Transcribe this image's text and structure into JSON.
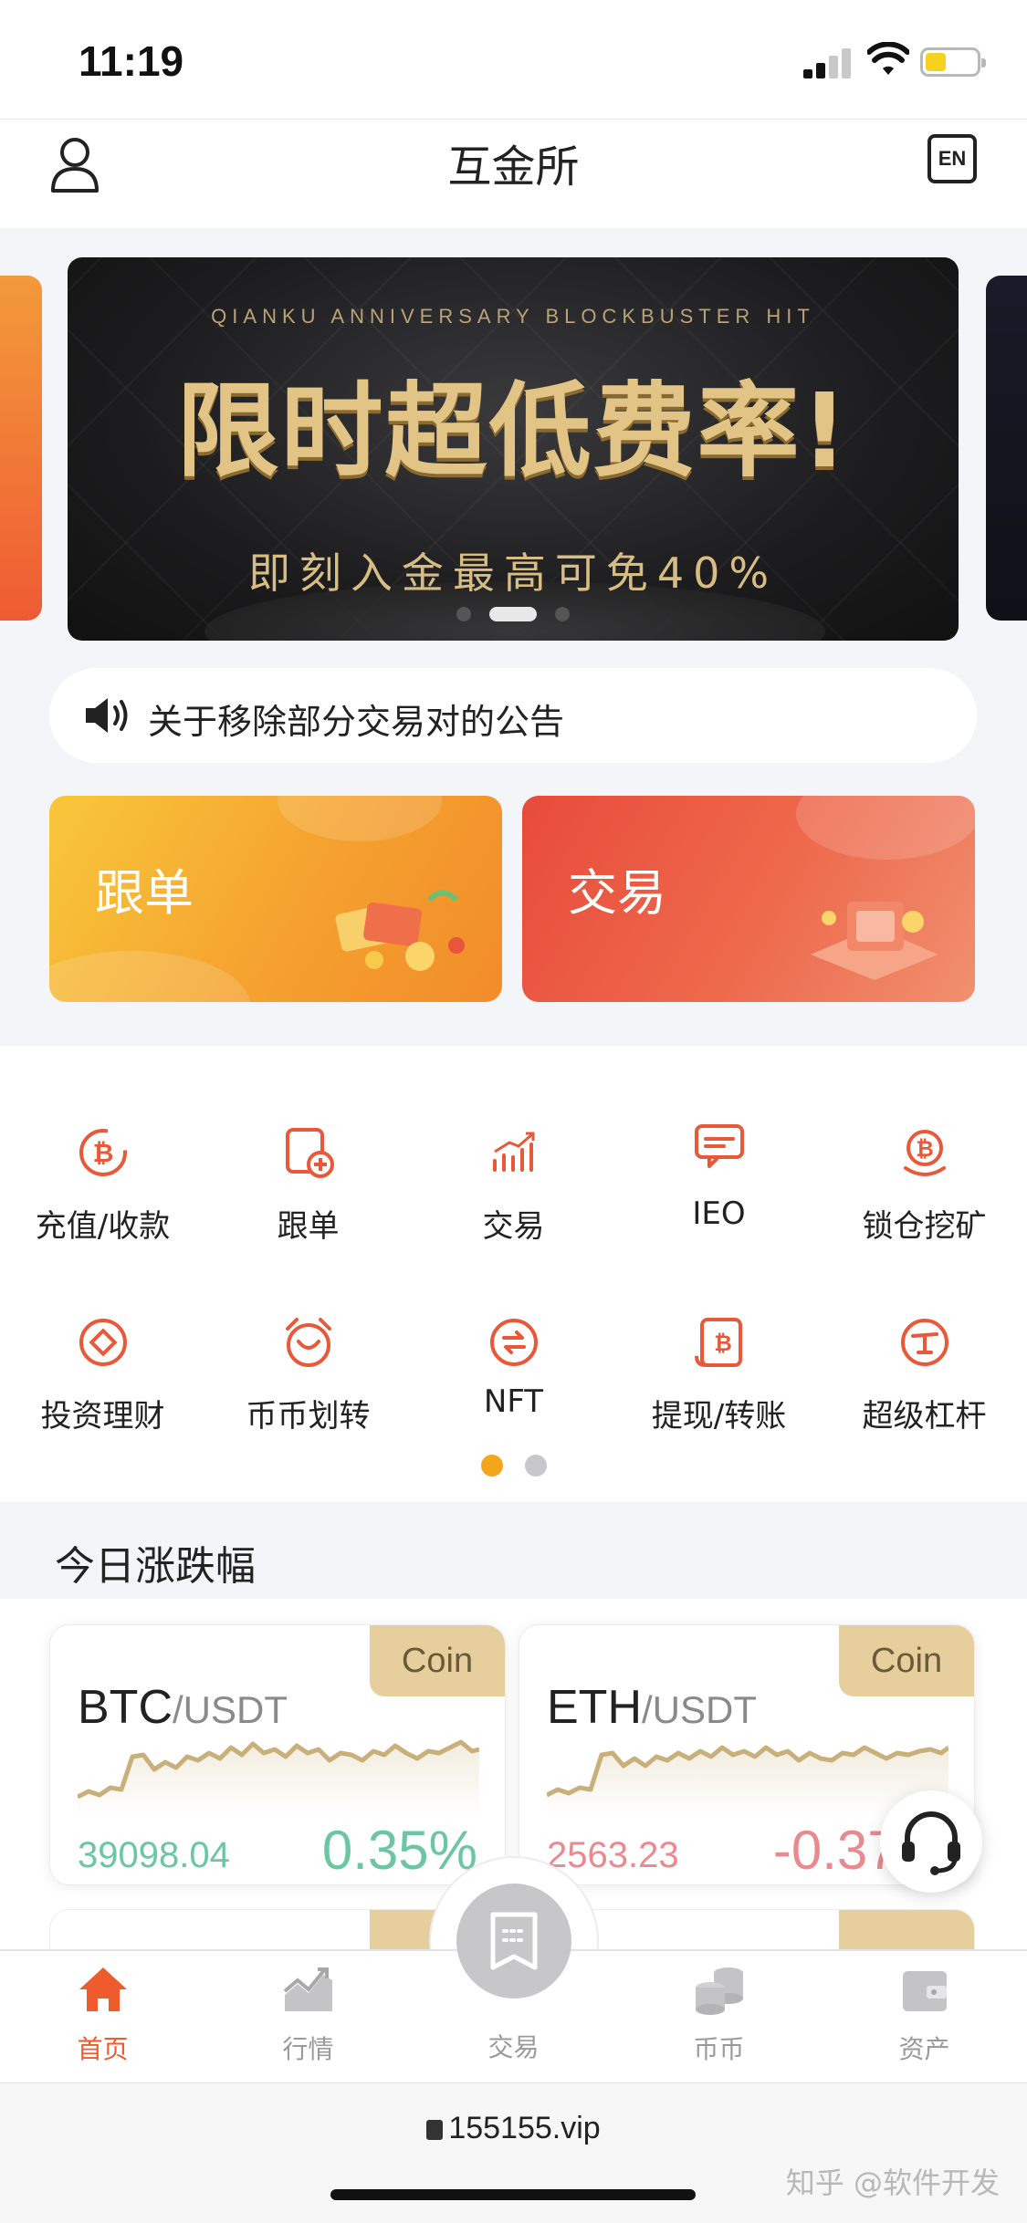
{
  "status_bar": {
    "time": "11:19"
  },
  "nav": {
    "title": "互金所",
    "lang_button": "EN"
  },
  "banner": {
    "subtitle": "QIANKU ANNIVERSARY BLOCKBUSTER HIT",
    "title": "限时超低费率!",
    "tagline": "即刻入金最高可免40%"
  },
  "notice": {
    "text": "关于移除部分交易对的公告"
  },
  "cards": {
    "follow": "跟单",
    "trade": "交易"
  },
  "menu": {
    "items": [
      {
        "label": "充值/收款",
        "icon": "deposit-icon"
      },
      {
        "label": "跟单",
        "icon": "copy-order-icon"
      },
      {
        "label": "交易",
        "icon": "trade-chart-icon"
      },
      {
        "label": "IEO",
        "icon": "ieo-chat-icon"
      },
      {
        "label": "锁仓挖矿",
        "icon": "lock-mining-icon"
      },
      {
        "label": "投资理财",
        "icon": "invest-icon"
      },
      {
        "label": "币币划转",
        "icon": "transfer-icon"
      },
      {
        "label": "NFT",
        "icon": "nft-icon"
      },
      {
        "label": "提现/转账",
        "icon": "withdraw-icon"
      },
      {
        "label": "超级杠杆",
        "icon": "leverage-icon"
      }
    ],
    "page_count": 2,
    "active_page": 1
  },
  "section": {
    "title": "今日涨跌幅"
  },
  "coins": [
    {
      "base": "BTC",
      "quote": "/USDT",
      "badge": "Coin",
      "price": "39098.04",
      "change": "0.35%",
      "direction": "up"
    },
    {
      "base": "ETH",
      "quote": "/USDT",
      "badge": "Coin",
      "price": "2563.23",
      "change": "-0.37%",
      "direction": "down"
    }
  ],
  "tabs": [
    {
      "label": "首页",
      "icon": "home-icon",
      "active": true
    },
    {
      "label": "行情",
      "icon": "market-icon",
      "active": false
    },
    {
      "label": "交易",
      "icon": "trade-icon",
      "active": false
    },
    {
      "label": "币币",
      "icon": "coins-icon",
      "active": false
    },
    {
      "label": "资产",
      "icon": "wallet-icon",
      "active": false
    }
  ],
  "browser": {
    "url": "155155.vip",
    "watermark": "知乎 @软件开发"
  },
  "colors": {
    "accent": "#ee5b2c",
    "up": "#6cc6a1",
    "down": "#e98a8f",
    "badge": "#e6cf9c",
    "dot_active": "#f4a51c"
  }
}
